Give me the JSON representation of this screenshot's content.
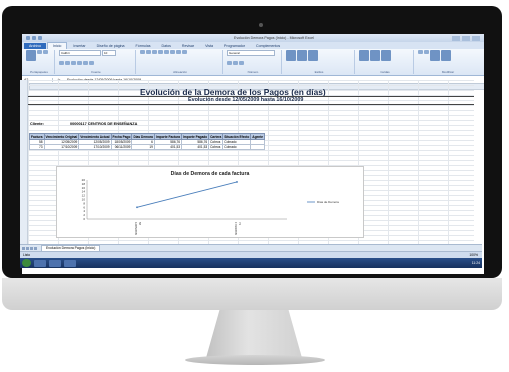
{
  "window": {
    "title": "Evolución Demora Pagos (Inicio) - Microsoft Excel"
  },
  "ribbon": {
    "tabs": [
      {
        "label": "Archivo"
      },
      {
        "label": "Inicio"
      },
      {
        "label": "Insertar"
      },
      {
        "label": "Diseño de página"
      },
      {
        "label": "Fórmulas"
      },
      {
        "label": "Datos"
      },
      {
        "label": "Revisar"
      },
      {
        "label": "Vista"
      },
      {
        "label": "Programador"
      },
      {
        "label": "Complementos"
      }
    ],
    "font_name": "Calibri",
    "font_size": "10",
    "number_format": "General",
    "groups": [
      {
        "label": "Portapapeles"
      },
      {
        "label": "Fuente"
      },
      {
        "label": "Alineación"
      },
      {
        "label": "Número"
      },
      {
        "label": "Estilos"
      },
      {
        "label": "Celdas"
      },
      {
        "label": "Modificar"
      }
    ]
  },
  "formula_bar": {
    "name_box": "A2",
    "fx": "fx",
    "content": "Evolución desde 12/05/2009 hasta 16/10/2009"
  },
  "sheet": {
    "heading": "Evolución de la Demora de los Pagos (en días)",
    "subheading": "Evolución desde 12/05/2009 hasta 16/10/2009",
    "client_label": "Cliente:",
    "client_value": "00000117 CENTROS DE ENSEÑANZA",
    "table": {
      "headers": [
        "Factura",
        "Vencimiento Original",
        "Vencimiento Actual",
        "Fecha Pago",
        "Días Demora",
        "Importe Factura",
        "Importe Pagado",
        "Cartera",
        "Situación Efecto",
        "Agente"
      ],
      "rows": [
        [
          "58",
          "12/05/2009",
          "12/05/2009",
          "18/05/2009",
          "6",
          "586,76",
          "586,76",
          "Cobros",
          "Cobrado",
          ""
        ],
        [
          "73",
          "17/10/2009",
          "17/10/2009",
          "06/11/2009",
          "19",
          "401,53",
          "401,53",
          "Cobros",
          "Cobrado",
          ""
        ]
      ]
    }
  },
  "chart_data": {
    "type": "line",
    "title": "Días de Demora de cada factura",
    "categories": [
      "12/05/2009 58",
      "17/10/2009 73"
    ],
    "series": [
      {
        "name": "Días de Demora",
        "values": [
          6,
          19
        ],
        "color": "#4a7ebb"
      }
    ],
    "yticks": [
      0,
      2,
      4,
      6,
      8,
      10,
      12,
      14,
      16,
      18,
      20
    ],
    "ylim": [
      0,
      20
    ],
    "grid": false,
    "legend": "right"
  },
  "sheet_tabs": [
    {
      "label": "Evolución Demora Pagos (Inicio)"
    }
  ],
  "status_bar": {
    "text": "Listo",
    "zoom": "100%"
  },
  "taskbar": {
    "clock": "11:24"
  }
}
